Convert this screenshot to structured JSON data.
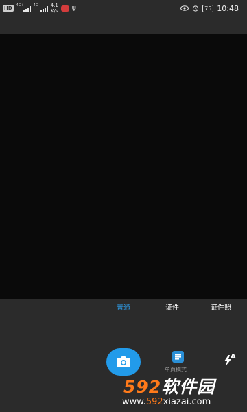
{
  "status_bar": {
    "hd": "HD",
    "signal1_type": "4G+",
    "signal2_type": "4G",
    "net_speed_value": "4.1",
    "net_speed_unit": "K/s",
    "battery": "75",
    "time": "10:48"
  },
  "mode_tabs": [
    {
      "label": "普通",
      "active": true
    },
    {
      "label": "证件",
      "active": false
    },
    {
      "label": "证件照",
      "active": false
    }
  ],
  "single_page_label": "单页模式",
  "flash_mode": "A",
  "watermark": {
    "title_num": "592",
    "title_text": "软件园",
    "url_prefix": "www.",
    "url_num": "592",
    "url_suffix": "xiazai.com"
  },
  "colors": {
    "accent": "#229bea",
    "active_tab": "#2e9be6",
    "viewfinder": "#0a0a0a",
    "panel": "#2b2b2b",
    "watermark_orange": "#ff7a1a"
  }
}
